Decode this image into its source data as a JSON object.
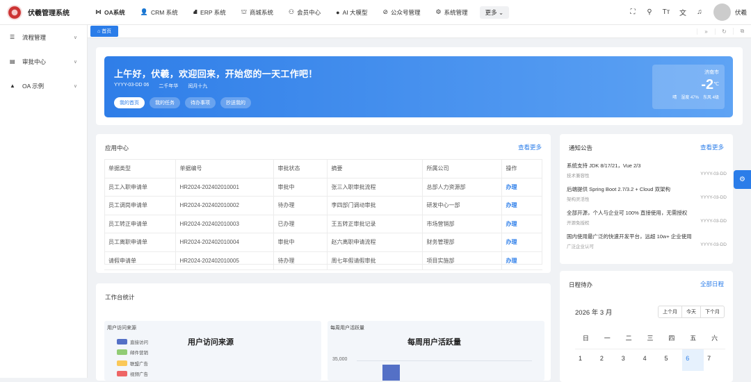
{
  "app": {
    "title": "伏羲管理系统"
  },
  "topnav": [
    {
      "label": "OA系统",
      "icon": "oa-icon",
      "glyph": "⋈"
    },
    {
      "label": "CRM 系统",
      "icon": "user-icon",
      "glyph": "👤"
    },
    {
      "label": "ERP 系统",
      "icon": "erp-icon",
      "glyph": "⛘"
    },
    {
      "label": "商城系统",
      "icon": "shop-icon",
      "glyph": "⛫"
    },
    {
      "label": "会员中心",
      "icon": "bike-icon",
      "glyph": "⚇"
    },
    {
      "label": "AI 大模型",
      "icon": "apple-icon",
      "glyph": "●"
    },
    {
      "label": "公众号管理",
      "icon": "compass-icon",
      "glyph": "⊘"
    },
    {
      "label": "系统管理",
      "icon": "gear-icon",
      "glyph": "⚙"
    }
  ],
  "more": "更多",
  "user": {
    "name": "伏羲"
  },
  "sidebar": [
    {
      "label": "流程管理",
      "icon": "list-icon",
      "glyph": "☰"
    },
    {
      "label": "审批中心",
      "icon": "table-icon",
      "glyph": "▤"
    },
    {
      "label": "OA 示例",
      "icon": "road-icon",
      "glyph": "▲"
    }
  ],
  "tab": {
    "home": "首页",
    "home_glyph": "⌂"
  },
  "welcome": {
    "title": "上午好，伏羲，欢迎回来，开始您的一天工作吧！",
    "date": "YYYY-03-DD 06",
    "lunar": "二千年华",
    "lunar_day": "闰月十九",
    "chips": [
      "我的首页",
      "我的任务",
      "待办事项",
      "抄送我的"
    ]
  },
  "weather": {
    "city": "济南市",
    "temp": "-2",
    "unit": "℃",
    "cond": "晴",
    "humidity": "湿度 47%",
    "wind": "东风 4级"
  },
  "app_center": {
    "title": "应用中心",
    "more": "查看更多",
    "columns": [
      "单据类型",
      "单据编号",
      "审批状态",
      "摘要",
      "所属公司",
      "操作"
    ],
    "rows": [
      [
        "员工入职申请单",
        "HR2024-202402010001",
        "审批中",
        "张三入职审批流程",
        "总部人力资源部",
        "办理"
      ],
      [
        "员工调岗申请单",
        "HR2024-202402010002",
        "待办理",
        "李四部门调动审批",
        "研发中心一部",
        "办理"
      ],
      [
        "员工转正申请单",
        "HR2024-202402010003",
        "已办理",
        "王五转正审批记录",
        "市场营销部",
        "办理"
      ],
      [
        "员工离职申请单",
        "HR2024-202402010004",
        "审批中",
        "赵六离职申请流程",
        "财务管理部",
        "办理"
      ],
      [
        "请假申请单",
        "HR2024-202402010005",
        "待办理",
        "周七年假请假审批",
        "项目实施部",
        "办理"
      ]
    ]
  },
  "notice": {
    "title": "通知公告",
    "more": "查看更多",
    "items": [
      {
        "title": "系统支持 JDK 8/17/21，Vue 2/3",
        "tag": "技术兼容性",
        "date": "YYYY-03-DD"
      },
      {
        "title": "后端提供 Spring Boot 2.7/3.2 + Cloud 双架构",
        "tag": "架构灵活性",
        "date": "YYYY-03-DD"
      },
      {
        "title": "全部开源，个人与企业可 100% 直接使用，无需授权",
        "tag": "开源免授权",
        "date": "YYYY-03-DD"
      },
      {
        "title": "国内使用最广泛的快速开发平台，远超 10w+ 企业使用",
        "tag": "广泛企业认可",
        "date": "YYYY-03-DD"
      }
    ]
  },
  "stats": {
    "title": "工作台统计",
    "source": {
      "label": "用户访问来源",
      "title": "用户访问来源",
      "legend": [
        {
          "name": "直接访问",
          "color": "#5470c6"
        },
        {
          "name": "邮件营销",
          "color": "#91cc75"
        },
        {
          "name": "联盟广告",
          "color": "#fac858"
        },
        {
          "name": "视频广告",
          "color": "#ee6666"
        }
      ]
    },
    "active": {
      "label": "每周用户活跃量",
      "title": "每周用户活跃量",
      "tick": "35,000"
    }
  },
  "schedule": {
    "title": "日程待办",
    "more": "全部日程",
    "month": "2026 年 3 月",
    "buttons": [
      "上个月",
      "今天",
      "下个月"
    ],
    "weekdays": [
      "日",
      "一",
      "二",
      "三",
      "四",
      "五",
      "六"
    ],
    "dates": [
      "1",
      "2",
      "3",
      "4",
      "5",
      "6",
      "7"
    ]
  },
  "colors": {
    "primary": "#2b7de9",
    "bar": "#5470c6"
  }
}
